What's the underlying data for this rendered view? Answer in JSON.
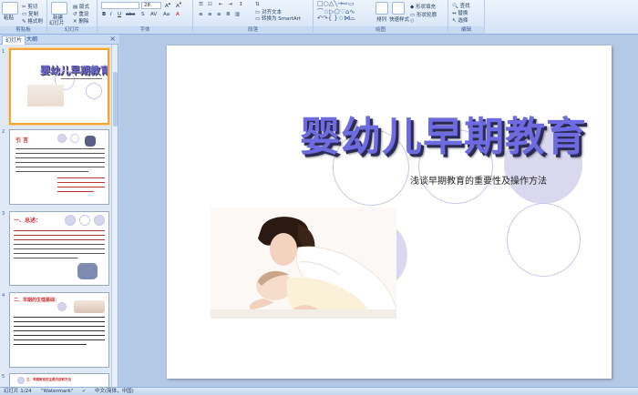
{
  "ribbon": {
    "groups": [
      "剪贴板",
      "幻灯片",
      "字体",
      "段落",
      "绘图",
      "编辑"
    ],
    "clipboard": {
      "paste": "粘贴",
      "cut": "剪切",
      "copy": "复制",
      "format": "格式刷"
    },
    "slides": {
      "new": "新建",
      "new2": "幻灯片",
      "layout": "版式",
      "reset": "重设",
      "delete": "删除"
    },
    "font": {
      "size": "28"
    },
    "paragraph": {
      "align_text": "对齐文本",
      "convert_smartart": "转换为 SmartArt"
    },
    "drawing": {
      "arrange": "排列",
      "quick_styles": "快速样式",
      "shape_fill": "形状填充",
      "shape_outline": "形状轮廓"
    },
    "editing": {
      "find": "查找",
      "replace": "替换",
      "select": "选择"
    }
  },
  "left_pane": {
    "tabs": [
      "幻灯片",
      "大纲"
    ],
    "close": "×",
    "thumbnails": [
      {
        "num": "1",
        "title": "婴幼儿早期教育"
      },
      {
        "num": "2",
        "title": "引 言"
      },
      {
        "num": "3",
        "title": "一、总述："
      },
      {
        "num": "4",
        "title": "二、早期的生理基础："
      },
      {
        "num": "5",
        "title": "三、早期教育的主要内容和方法"
      }
    ]
  },
  "slide": {
    "title": "婴幼儿早期教育",
    "subtitle": "浅谈早期教育的重要性及操作方法"
  },
  "status": {
    "slide_info": "幻灯片 1/24",
    "theme": "\"Watermark\"",
    "language": "中文(简体，中国)"
  }
}
